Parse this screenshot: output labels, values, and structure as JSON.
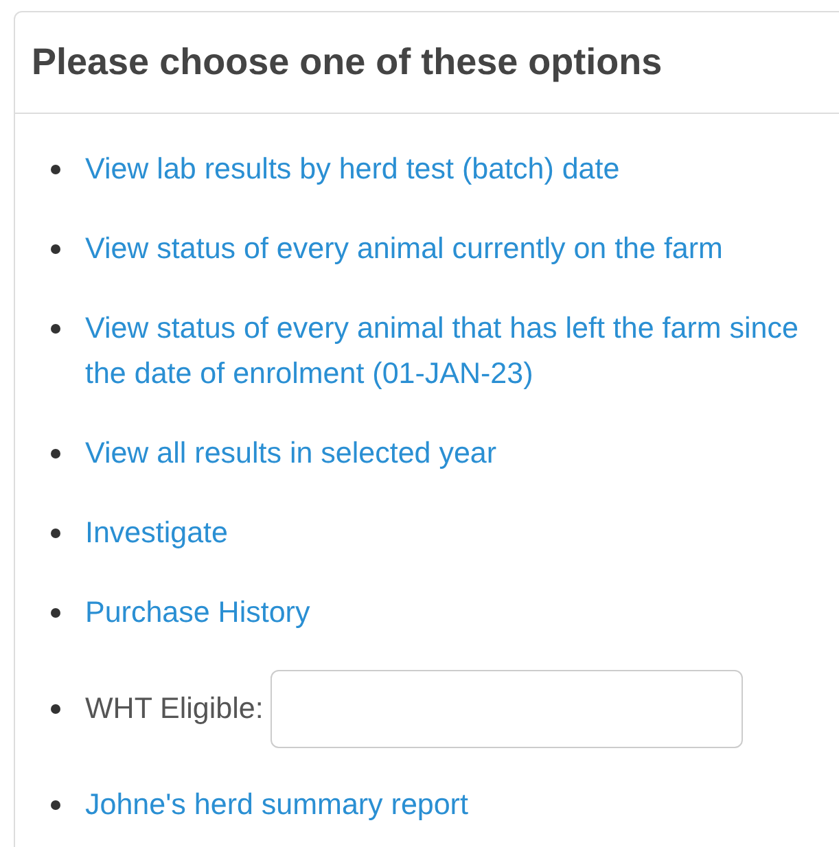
{
  "panel": {
    "title": "Please choose one of these options",
    "options": [
      {
        "kind": "link",
        "text": "View lab results by herd test (batch) date"
      },
      {
        "kind": "link",
        "text": "View status of every animal currently on the farm"
      },
      {
        "kind": "link",
        "text": "View status of every animal that has left the farm since the date of enrolment (01-JAN-23)"
      },
      {
        "kind": "link",
        "text": "View all results in selected year"
      },
      {
        "kind": "link",
        "text": "Investigate"
      },
      {
        "kind": "link",
        "text": "Purchase History"
      },
      {
        "kind": "field",
        "label": "WHT Eligible:"
      },
      {
        "kind": "link",
        "text": "Johne's herd summary report"
      }
    ]
  }
}
